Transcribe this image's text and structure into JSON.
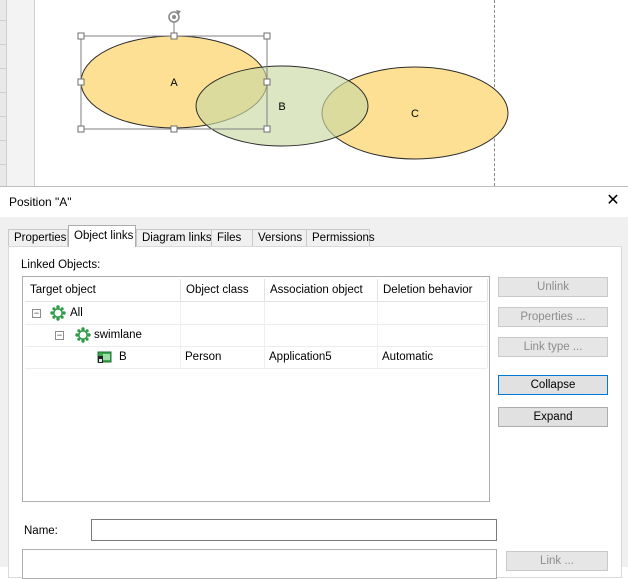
{
  "canvas": {
    "shapes": [
      {
        "name": "A",
        "fill": "#fde093",
        "stroke": "#2b2b2b",
        "selected": true
      },
      {
        "name": "B",
        "fill": "#d6e3bd",
        "stroke": "#2b2b2b",
        "selected": false
      },
      {
        "name": "C",
        "fill": "#fde093",
        "stroke": "#2b2b2b",
        "selected": false
      }
    ],
    "selection_color": "#7f7f7f",
    "rotate_icon": "rotate-icon"
  },
  "dialog": {
    "title": "Position \"A\"",
    "close_icon": "close-icon",
    "tabs": [
      {
        "label": "Properties",
        "active": false
      },
      {
        "label": "Object links",
        "active": true
      },
      {
        "label": "Diagram links",
        "active": false
      },
      {
        "label": "Files",
        "active": false
      },
      {
        "label": "Versions",
        "active": false
      },
      {
        "label": "Permissions",
        "active": false
      }
    ],
    "linked_objects_label": "Linked Objects:",
    "columns": [
      "Target object",
      "Object class",
      "Association object",
      "Deletion behavior"
    ],
    "rows": [
      {
        "expander": "−",
        "icon": "group-icon",
        "label": "All",
        "object_class": "",
        "association": "",
        "deletion": ""
      },
      {
        "expander": "−",
        "icon": "group-icon",
        "label": "swimlane",
        "object_class": "",
        "association": "",
        "deletion": ""
      },
      {
        "expander": "",
        "icon": "person-object-icon",
        "label": "B",
        "object_class": "Person",
        "association": "Application5",
        "deletion": "Automatic"
      }
    ],
    "buttons": {
      "unlink": "Unlink",
      "properties": "Properties ...",
      "link_type": "Link type ...",
      "collapse": "Collapse",
      "expand": "Expand",
      "link": "Link ..."
    },
    "name_label": "Name:",
    "name_value": "",
    "accent_color": "#0078d7",
    "icon_green": "#2e9b46"
  }
}
